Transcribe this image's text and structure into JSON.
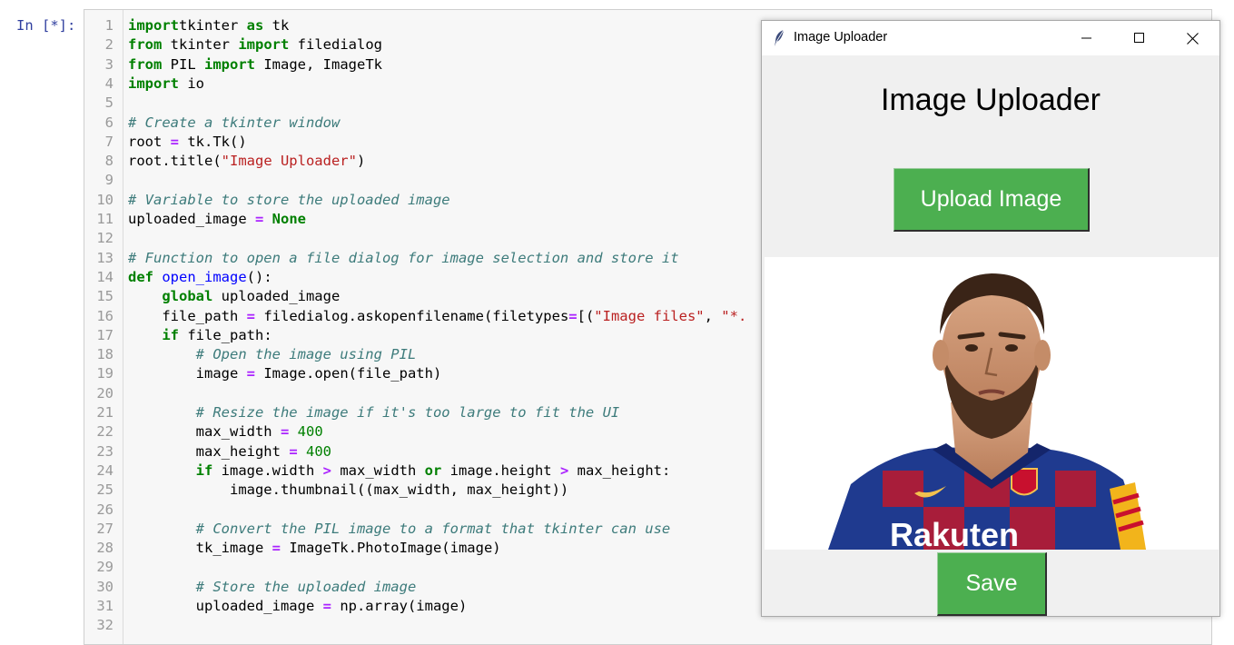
{
  "notebook": {
    "prompt": "In [*]:",
    "lines": [
      {
        "n": "1",
        "t": [
          [
            "kw",
            "import"
          ],
          [
            "",
            "tkinter "
          ],
          [
            "kw",
            "as"
          ],
          [
            "",
            " tk"
          ]
        ]
      },
      {
        "n": "2",
        "t": [
          [
            "kw",
            "from"
          ],
          [
            "",
            " tkinter "
          ],
          [
            "kw",
            "import"
          ],
          [
            "",
            " filedialog"
          ]
        ]
      },
      {
        "n": "3",
        "t": [
          [
            "kw",
            "from"
          ],
          [
            "",
            " PIL "
          ],
          [
            "kw",
            "import"
          ],
          [
            "",
            " Image, ImageTk"
          ]
        ]
      },
      {
        "n": "4",
        "t": [
          [
            "kw",
            "import"
          ],
          [
            "",
            " io"
          ]
        ]
      },
      {
        "n": "5",
        "t": []
      },
      {
        "n": "6",
        "t": [
          [
            "cm",
            "# Create a tkinter window"
          ]
        ]
      },
      {
        "n": "7",
        "t": [
          [
            "",
            "root "
          ],
          [
            "op",
            "="
          ],
          [
            "",
            " tk.Tk()"
          ]
        ]
      },
      {
        "n": "8",
        "t": [
          [
            "",
            "root.title("
          ],
          [
            "st",
            "\"Image Uploader\""
          ],
          [
            "",
            ")"
          ]
        ]
      },
      {
        "n": "9",
        "t": []
      },
      {
        "n": "10",
        "t": [
          [
            "cm",
            "# Variable to store the uploaded image"
          ]
        ]
      },
      {
        "n": "11",
        "t": [
          [
            "",
            "uploaded_image "
          ],
          [
            "op",
            "="
          ],
          [
            "",
            " "
          ],
          [
            "kw",
            "None"
          ]
        ]
      },
      {
        "n": "12",
        "t": []
      },
      {
        "n": "13",
        "t": [
          [
            "cm",
            "# Function to open a file dialog for image selection and store it"
          ]
        ]
      },
      {
        "n": "14",
        "t": [
          [
            "kw",
            "def"
          ],
          [
            "",
            " "
          ],
          [
            "fn",
            "open_image"
          ],
          [
            "",
            "():"
          ]
        ]
      },
      {
        "n": "15",
        "t": [
          [
            "",
            "    "
          ],
          [
            "kw",
            "global"
          ],
          [
            "",
            " uploaded_image"
          ]
        ]
      },
      {
        "n": "16",
        "t": [
          [
            "",
            "    file_path "
          ],
          [
            "op",
            "="
          ],
          [
            "",
            " filedialog.askopenfilename(filetypes"
          ],
          [
            "op",
            "="
          ],
          [
            "",
            "[("
          ],
          [
            "st",
            "\"Image files\""
          ],
          [
            "",
            ", "
          ],
          [
            "st",
            "\"*."
          ]
        ]
      },
      {
        "n": "17",
        "t": [
          [
            "",
            "    "
          ],
          [
            "kw",
            "if"
          ],
          [
            "",
            " file_path:"
          ]
        ]
      },
      {
        "n": "18",
        "t": [
          [
            "",
            "        "
          ],
          [
            "cm",
            "# Open the image using PIL"
          ]
        ]
      },
      {
        "n": "19",
        "t": [
          [
            "",
            "        image "
          ],
          [
            "op",
            "="
          ],
          [
            "",
            " Image.open(file_path)"
          ]
        ]
      },
      {
        "n": "20",
        "t": []
      },
      {
        "n": "21",
        "t": [
          [
            "",
            "        "
          ],
          [
            "cm",
            "# Resize the image if it's too large to fit the UI"
          ]
        ]
      },
      {
        "n": "22",
        "t": [
          [
            "",
            "        max_width "
          ],
          [
            "op",
            "="
          ],
          [
            "",
            " "
          ],
          [
            "nm",
            "400"
          ]
        ]
      },
      {
        "n": "23",
        "t": [
          [
            "",
            "        max_height "
          ],
          [
            "op",
            "="
          ],
          [
            "",
            " "
          ],
          [
            "nm",
            "400"
          ]
        ]
      },
      {
        "n": "24",
        "t": [
          [
            "",
            "        "
          ],
          [
            "kw",
            "if"
          ],
          [
            "",
            " image.width "
          ],
          [
            "op",
            ">"
          ],
          [
            "",
            " max_width "
          ],
          [
            "kw",
            "or"
          ],
          [
            "",
            " image.height "
          ],
          [
            "op",
            ">"
          ],
          [
            "",
            " max_height:"
          ]
        ]
      },
      {
        "n": "25",
        "t": [
          [
            "",
            "            image.thumbnail((max_width, max_height))"
          ]
        ]
      },
      {
        "n": "26",
        "t": []
      },
      {
        "n": "27",
        "t": [
          [
            "",
            "        "
          ],
          [
            "cm",
            "# Convert the PIL image to a format that tkinter can use"
          ]
        ]
      },
      {
        "n": "28",
        "t": [
          [
            "",
            "        tk_image "
          ],
          [
            "op",
            "="
          ],
          [
            "",
            " ImageTk.PhotoImage(image)"
          ]
        ]
      },
      {
        "n": "29",
        "t": []
      },
      {
        "n": "30",
        "t": [
          [
            "",
            "        "
          ],
          [
            "cm",
            "# Store the uploaded image"
          ]
        ]
      },
      {
        "n": "31",
        "t": [
          [
            "",
            "        uploaded_image "
          ],
          [
            "op",
            "="
          ],
          [
            "",
            " np.array(image)"
          ]
        ]
      },
      {
        "n": "32",
        "t": []
      }
    ]
  },
  "window": {
    "title": "Image Uploader",
    "heading": "Image Uploader",
    "upload_label": "Upload Image",
    "save_label": "Save",
    "photo_jersey_text": "Rakuten",
    "accent": "#4caf50"
  }
}
